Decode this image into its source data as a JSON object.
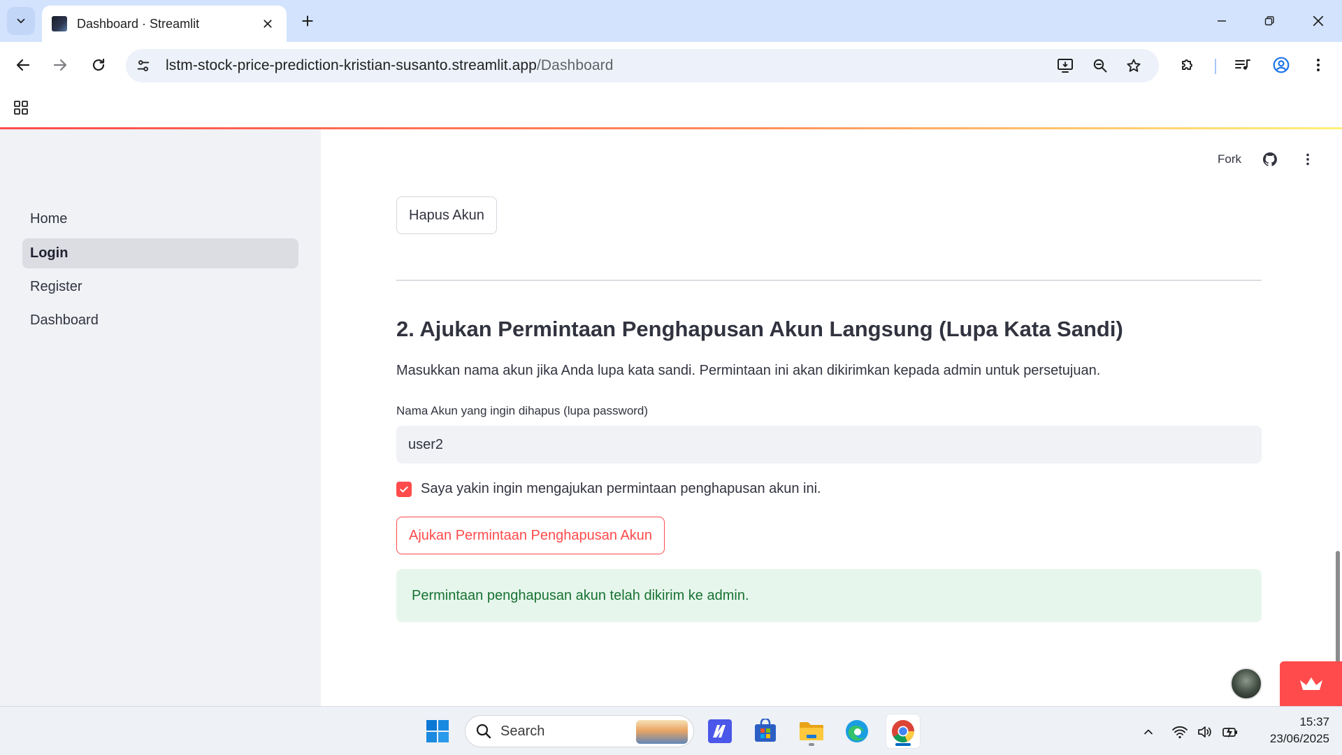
{
  "browser": {
    "tab_title": "Dashboard · Streamlit",
    "url_host": "lstm-stock-price-prediction-kristian-susanto.streamlit.app",
    "url_path": "/Dashboard"
  },
  "sidebar": {
    "items": [
      {
        "label": "Home",
        "active": false
      },
      {
        "label": "Login",
        "active": true
      },
      {
        "label": "Register",
        "active": false
      },
      {
        "label": "Dashboard",
        "active": false
      }
    ]
  },
  "header": {
    "fork_label": "Fork"
  },
  "main": {
    "delete_button_label": "Hapus Akun",
    "section_title": "2. Ajukan Permintaan Penghapusan Akun Langsung (Lupa Kata Sandi)",
    "section_description": "Masukkan nama akun jika Anda lupa kata sandi. Permintaan ini akan dikirimkan kepada admin untuk persetujuan.",
    "account_field_label": "Nama Akun yang ingin dihapus (lupa password)",
    "account_field_value": "user2",
    "confirm_checkbox_label": "Saya yakin ingin mengajukan permintaan penghapusan akun ini.",
    "confirm_checkbox_checked": true,
    "submit_button_label": "Ajukan Permintaan Penghapusan Akun",
    "success_message": "Permintaan penghapusan akun telah dikirim ke admin."
  },
  "taskbar": {
    "search_placeholder": "Search",
    "time": "15:37",
    "date": "23/06/2025"
  },
  "colors": {
    "accent": "#ff4b4b",
    "success_bg": "#e7f6ec",
    "success_text": "#177233",
    "sidebar_bg": "#f0f2f6"
  }
}
